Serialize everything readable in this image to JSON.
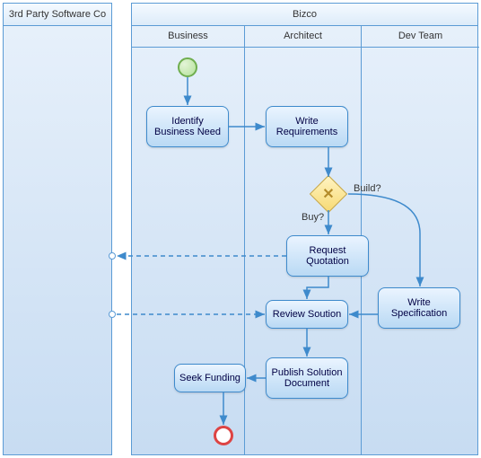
{
  "pools": {
    "thirdParty": {
      "title": "3rd Party Software Co"
    },
    "bizco": {
      "title": "Bizco",
      "lanes": {
        "business": "Business",
        "architect": "Architect",
        "devteam": "Dev Team"
      }
    }
  },
  "tasks": {
    "identify": "Identify Business Need",
    "writeReq": "Write Requirements",
    "requestQ": "Request Quotation",
    "writeSpec": "Write Specification",
    "reviewSol": "Review Soution",
    "publish": "Publish Solution Document",
    "seekFund": "Seek Funding"
  },
  "gateway": {
    "build": "Build?",
    "buy": "Buy?"
  },
  "chart_data": {
    "type": "table",
    "diagram_type": "BPMN",
    "pools": [
      {
        "id": "thirdParty",
        "name": "3rd Party Software Co",
        "lanes": []
      },
      {
        "id": "bizco",
        "name": "Bizco",
        "lanes": [
          "Business",
          "Architect",
          "Dev Team"
        ]
      }
    ],
    "nodes": [
      {
        "id": "start",
        "type": "start-event",
        "pool": "bizco",
        "lane": "Business"
      },
      {
        "id": "identify",
        "type": "task",
        "label": "Identify Business Need",
        "pool": "bizco",
        "lane": "Business"
      },
      {
        "id": "writeReq",
        "type": "task",
        "label": "Write Requirements",
        "pool": "bizco",
        "lane": "Architect"
      },
      {
        "id": "gw",
        "type": "exclusive-gateway",
        "pool": "bizco",
        "lane": "Architect"
      },
      {
        "id": "requestQ",
        "type": "task",
        "label": "Request Quotation",
        "pool": "bizco",
        "lane": "Architect"
      },
      {
        "id": "writeSpec",
        "type": "task",
        "label": "Write Specification",
        "pool": "bizco",
        "lane": "Dev Team"
      },
      {
        "id": "reviewSol",
        "type": "task",
        "label": "Review Soution",
        "pool": "bizco",
        "lane": "Architect"
      },
      {
        "id": "publish",
        "type": "task",
        "label": "Publish Solution Document",
        "pool": "bizco",
        "lane": "Architect"
      },
      {
        "id": "seekFund",
        "type": "task",
        "label": "Seek Funding",
        "pool": "bizco",
        "lane": "Business"
      },
      {
        "id": "end",
        "type": "end-event",
        "pool": "bizco",
        "lane": "Business"
      }
    ],
    "sequence_flows": [
      {
        "from": "start",
        "to": "identify"
      },
      {
        "from": "identify",
        "to": "writeReq"
      },
      {
        "from": "writeReq",
        "to": "gw"
      },
      {
        "from": "gw",
        "to": "requestQ",
        "condition": "Buy?"
      },
      {
        "from": "gw",
        "to": "writeSpec",
        "condition": "Build?"
      },
      {
        "from": "requestQ",
        "to": "reviewSol"
      },
      {
        "from": "writeSpec",
        "to": "reviewSol"
      },
      {
        "from": "reviewSol",
        "to": "publish"
      },
      {
        "from": "publish",
        "to": "seekFund"
      },
      {
        "from": "seekFund",
        "to": "end"
      }
    ],
    "message_flows": [
      {
        "from": "requestQ",
        "to": "thirdParty"
      },
      {
        "from": "thirdParty",
        "to": "reviewSol"
      }
    ]
  }
}
